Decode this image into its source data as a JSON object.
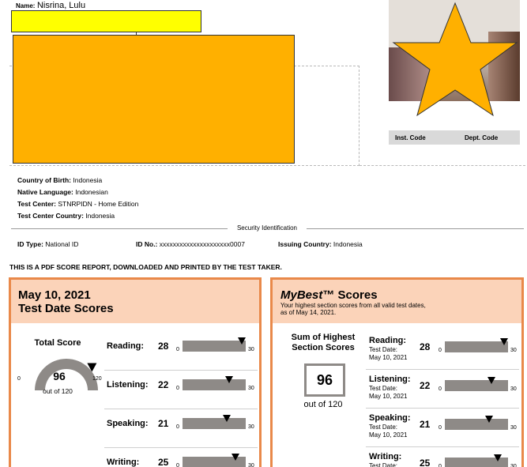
{
  "header": {
    "name_label": "Name:",
    "name_value": "Nisrina, Lulu",
    "inst_code_label": "Inst. Code",
    "dept_code_label": "Dept. Code"
  },
  "info": {
    "country_of_birth_label": "Country of Birth:",
    "country_of_birth": "Indonesia",
    "native_language_label": "Native Language:",
    "native_language": "Indonesian",
    "test_center_label": "Test Center:",
    "test_center": "STNRPIDN - Home Edition",
    "test_center_country_label": "Test Center Country:",
    "test_center_country": "Indonesia"
  },
  "security": {
    "title": "Security Identification",
    "id_type_label": "ID Type:",
    "id_type": "National ID",
    "id_no_label": "ID No.:",
    "id_no": "xxxxxxxxxxxxxxxxxxxxx0007",
    "issuing_country_label": "Issuing Country:",
    "issuing_country": "Indonesia"
  },
  "pdf_note": "THIS IS A PDF SCORE REPORT, DOWNLOADED AND PRINTED BY THE TEST TAKER.",
  "test_date_panel": {
    "date": "May 10, 2021",
    "title": "Test Date Scores",
    "total_label": "Total Score",
    "total": 96,
    "total_min": "0",
    "total_max": "120",
    "out_of": "out of 120",
    "sections": [
      {
        "name": "Reading:",
        "score": 28,
        "min": "0",
        "max": "30"
      },
      {
        "name": "Listening:",
        "score": 22,
        "min": "0",
        "max": "30"
      },
      {
        "name": "Speaking:",
        "score": 21,
        "min": "0",
        "max": "30"
      },
      {
        "name": "Writing:",
        "score": 25,
        "min": "0",
        "max": "30"
      }
    ]
  },
  "mybest_panel": {
    "title_italic": "MyBest",
    "title_tm": "™",
    "title_rest": " Scores",
    "subtitle_line1": "Your highest section scores from all valid test dates,",
    "subtitle_line2": "as of May 14, 2021.",
    "sum_label_line1": "Sum of Highest",
    "sum_label_line2": "Section Scores",
    "sum": 96,
    "out_of": "out of 120",
    "test_date_label": "Test Date:",
    "sections": [
      {
        "name": "Reading:",
        "score": 28,
        "date": "May 10, 2021",
        "min": "0",
        "max": "30"
      },
      {
        "name": "Listening:",
        "score": 22,
        "date": "May 10, 2021",
        "min": "0",
        "max": "30"
      },
      {
        "name": "Speaking:",
        "score": 21,
        "date": "May 10, 2021",
        "min": "0",
        "max": "30"
      },
      {
        "name": "Writing:",
        "score": 25,
        "date": "",
        "min": "0",
        "max": "30"
      }
    ]
  },
  "colors": {
    "panel_border": "#e9894a",
    "panel_header": "#fbd3b9",
    "bar": "#8e8a87",
    "redaction_yellow": "#ffff00",
    "redaction_orange": "#ffb000"
  }
}
